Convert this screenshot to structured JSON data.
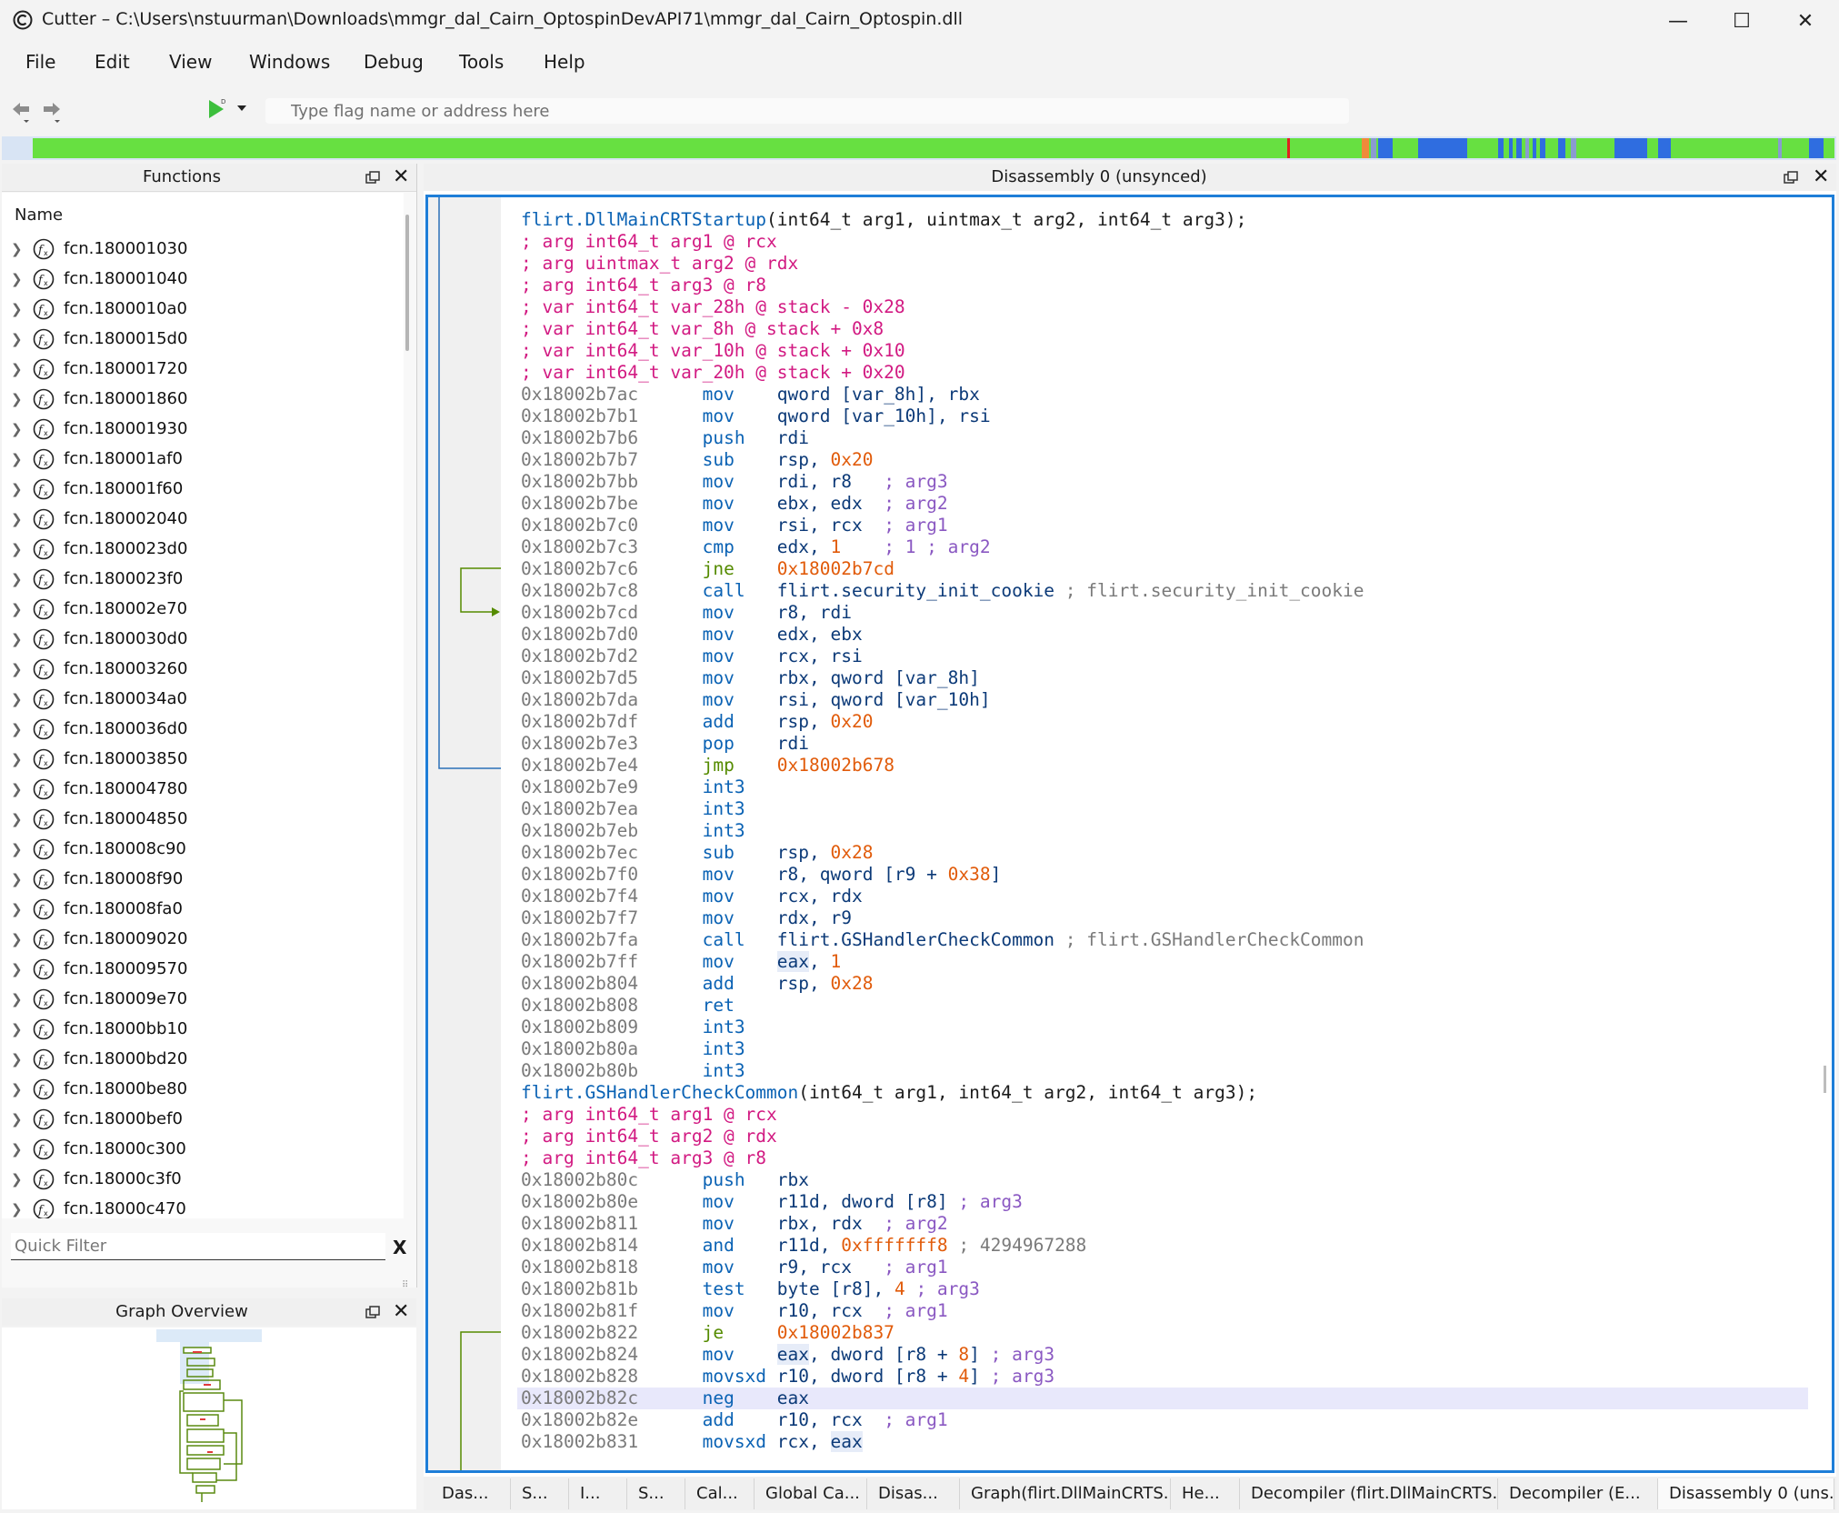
{
  "window": {
    "title": "Cutter – C:\\Users\\nstuurman\\Downloads\\mmgr_dal_Cairn_OptospinDevAPI71\\mmgr_dal_Cairn_Optospin.dll",
    "minimize_glyph": "—",
    "maximize_glyph": "☐",
    "close_glyph": "✕"
  },
  "menu": [
    "File",
    "Edit",
    "View",
    "Windows",
    "Debug",
    "Tools",
    "Help"
  ],
  "toolbar": {
    "search_placeholder": "Type flag name or address here",
    "run_badge": "D"
  },
  "colors": {
    "map_code": "#67e041",
    "map_data": "#2f6de0",
    "map_marker": "#e02020",
    "focus_border": "#1e7ed8"
  },
  "functions_panel": {
    "title": "Functions",
    "column": "Name",
    "filter_placeholder": "Quick Filter",
    "filter_clear": "X",
    "items": [
      "fcn.180001030",
      "fcn.180001040",
      "fcn.1800010a0",
      "fcn.1800015d0",
      "fcn.180001720",
      "fcn.180001860",
      "fcn.180001930",
      "fcn.180001af0",
      "fcn.180001f60",
      "fcn.180002040",
      "fcn.1800023d0",
      "fcn.1800023f0",
      "fcn.180002e70",
      "fcn.1800030d0",
      "fcn.180003260",
      "fcn.1800034a0",
      "fcn.1800036d0",
      "fcn.180003850",
      "fcn.180004780",
      "fcn.180004850",
      "fcn.180008c90",
      "fcn.180008f90",
      "fcn.180008fa0",
      "fcn.180009020",
      "fcn.180009570",
      "fcn.180009e70",
      "fcn.18000bb10",
      "fcn.18000bd20",
      "fcn.18000be80",
      "fcn.18000bef0",
      "fcn.18000c300",
      "fcn.18000c3f0",
      "fcn.18000c470"
    ]
  },
  "graph_overview": {
    "title": "Graph Overview"
  },
  "disassembly": {
    "title": "Disassembly 0 (unsynced)",
    "lines": [
      {
        "k": "fn",
        "name": "flirt.DllMainCRTStartup",
        "sig": "(int64_t arg1, uintmax_t arg2, int64_t arg3);"
      },
      {
        "k": "var",
        "text": "; arg int64_t arg1 @ rcx"
      },
      {
        "k": "var",
        "text": "; arg uintmax_t arg2 @ rdx"
      },
      {
        "k": "var",
        "text": "; arg int64_t arg3 @ r8"
      },
      {
        "k": "var",
        "text": "; var int64_t var_28h @ stack - 0x28"
      },
      {
        "k": "var",
        "text": "; var int64_t var_8h @ stack + 0x8"
      },
      {
        "k": "var",
        "text": "; var int64_t var_10h @ stack + 0x10"
      },
      {
        "k": "var",
        "text": "; var int64_t var_20h @ stack + 0x20"
      },
      {
        "a": "0x18002b7ac",
        "m": "mov",
        "o": [
          [
            "qword [var_8h], rbx",
            "op"
          ]
        ]
      },
      {
        "a": "0x18002b7b1",
        "m": "mov",
        "o": [
          [
            "qword [var_10h], rsi",
            "op"
          ]
        ]
      },
      {
        "a": "0x18002b7b6",
        "m": "push",
        "o": [
          [
            "rdi",
            "op"
          ]
        ]
      },
      {
        "a": "0x18002b7b7",
        "m": "sub",
        "o": [
          [
            "rsp, ",
            "op"
          ],
          [
            "0x20",
            "num"
          ]
        ]
      },
      {
        "a": "0x18002b7bb",
        "m": "mov",
        "o": [
          [
            "rdi, r8   ",
            "op"
          ],
          [
            "; arg3",
            "cmt"
          ]
        ]
      },
      {
        "a": "0x18002b7be",
        "m": "mov",
        "o": [
          [
            "ebx, edx  ",
            "op"
          ],
          [
            "; arg2",
            "cmt"
          ]
        ]
      },
      {
        "a": "0x18002b7c0",
        "m": "mov",
        "o": [
          [
            "rsi, rcx  ",
            "op"
          ],
          [
            "; arg1",
            "cmt"
          ]
        ]
      },
      {
        "a": "0x18002b7c3",
        "m": "cmp",
        "o": [
          [
            "edx, ",
            "op"
          ],
          [
            "1",
            "num"
          ],
          [
            "    ",
            "op"
          ],
          [
            "; 1 ; arg2",
            "cmt"
          ]
        ]
      },
      {
        "a": "0x18002b7c6",
        "m": "jne",
        "j": true,
        "o": [
          [
            "0x18002b7cd",
            "num"
          ]
        ]
      },
      {
        "a": "0x18002b7c8",
        "m": "call",
        "o": [
          [
            "flirt.security_init_cookie ",
            "op"
          ],
          [
            "; flirt.security_init_cookie",
            "ref"
          ]
        ]
      },
      {
        "a": "0x18002b7cd",
        "m": "mov",
        "o": [
          [
            "r8, rdi",
            "op"
          ]
        ]
      },
      {
        "a": "0x18002b7d0",
        "m": "mov",
        "o": [
          [
            "edx, ebx",
            "op"
          ]
        ]
      },
      {
        "a": "0x18002b7d2",
        "m": "mov",
        "o": [
          [
            "rcx, rsi",
            "op"
          ]
        ]
      },
      {
        "a": "0x18002b7d5",
        "m": "mov",
        "o": [
          [
            "rbx, qword [var_8h]",
            "op"
          ]
        ]
      },
      {
        "a": "0x18002b7da",
        "m": "mov",
        "o": [
          [
            "rsi, qword [var_10h]",
            "op"
          ]
        ]
      },
      {
        "a": "0x18002b7df",
        "m": "add",
        "o": [
          [
            "rsp, ",
            "op"
          ],
          [
            "0x20",
            "num"
          ]
        ]
      },
      {
        "a": "0x18002b7e3",
        "m": "pop",
        "o": [
          [
            "rdi",
            "op"
          ]
        ]
      },
      {
        "a": "0x18002b7e4",
        "m": "jmp",
        "j": true,
        "o": [
          [
            "0x18002b678",
            "num"
          ]
        ]
      },
      {
        "a": "0x18002b7e9",
        "m": "int3",
        "o": []
      },
      {
        "a": "0x18002b7ea",
        "m": "int3",
        "o": []
      },
      {
        "a": "0x18002b7eb",
        "m": "int3",
        "o": []
      },
      {
        "a": "0x18002b7ec",
        "m": "sub",
        "o": [
          [
            "rsp, ",
            "op"
          ],
          [
            "0x28",
            "num"
          ]
        ]
      },
      {
        "a": "0x18002b7f0",
        "m": "mov",
        "o": [
          [
            "r8, qword [r9 + ",
            "op"
          ],
          [
            "0x38",
            "num"
          ],
          [
            "]",
            "op"
          ]
        ]
      },
      {
        "a": "0x18002b7f4",
        "m": "mov",
        "o": [
          [
            "rcx, rdx",
            "op"
          ]
        ]
      },
      {
        "a": "0x18002b7f7",
        "m": "mov",
        "o": [
          [
            "rdx, r9",
            "op"
          ]
        ]
      },
      {
        "a": "0x18002b7fa",
        "m": "call",
        "o": [
          [
            "flirt.GSHandlerCheckCommon ",
            "op"
          ],
          [
            "; flirt.GSHandlerCheckCommon",
            "ref"
          ]
        ]
      },
      {
        "a": "0x18002b7ff",
        "m": "mov",
        "o": [
          [
            "eax",
            "hl"
          ],
          [
            ", ",
            "op"
          ],
          [
            "1",
            "num"
          ]
        ]
      },
      {
        "a": "0x18002b804",
        "m": "add",
        "o": [
          [
            "rsp, ",
            "op"
          ],
          [
            "0x28",
            "num"
          ]
        ]
      },
      {
        "a": "0x18002b808",
        "m": "ret",
        "o": []
      },
      {
        "a": "0x18002b809",
        "m": "int3",
        "o": []
      },
      {
        "a": "0x18002b80a",
        "m": "int3",
        "o": []
      },
      {
        "a": "0x18002b80b",
        "m": "int3",
        "o": []
      },
      {
        "k": "fn",
        "name": "flirt.GSHandlerCheckCommon",
        "sig": "(int64_t arg1, int64_t arg2, int64_t arg3);"
      },
      {
        "k": "var",
        "text": "; arg int64_t arg1 @ rcx"
      },
      {
        "k": "var",
        "text": "; arg int64_t arg2 @ rdx"
      },
      {
        "k": "var",
        "text": "; arg int64_t arg3 @ r8"
      },
      {
        "a": "0x18002b80c",
        "m": "push",
        "o": [
          [
            "rbx",
            "op"
          ]
        ]
      },
      {
        "a": "0x18002b80e",
        "m": "mov",
        "o": [
          [
            "r11d, dword [r8] ",
            "op"
          ],
          [
            "; arg3",
            "cmt"
          ]
        ]
      },
      {
        "a": "0x18002b811",
        "m": "mov",
        "o": [
          [
            "rbx, rdx  ",
            "op"
          ],
          [
            "; arg2",
            "cmt"
          ]
        ]
      },
      {
        "a": "0x18002b814",
        "m": "and",
        "o": [
          [
            "r11d, ",
            "op"
          ],
          [
            "0xfffffff8",
            "num"
          ],
          [
            " ",
            "op"
          ],
          [
            "; 4294967288",
            "ref"
          ]
        ]
      },
      {
        "a": "0x18002b818",
        "m": "mov",
        "o": [
          [
            "r9, rcx   ",
            "op"
          ],
          [
            "; arg1",
            "cmt"
          ]
        ]
      },
      {
        "a": "0x18002b81b",
        "m": "test",
        "o": [
          [
            "byte [r8], ",
            "op"
          ],
          [
            "4",
            "num"
          ],
          [
            " ",
            "op"
          ],
          [
            "; arg3",
            "cmt"
          ]
        ]
      },
      {
        "a": "0x18002b81f",
        "m": "mov",
        "o": [
          [
            "r10, rcx  ",
            "op"
          ],
          [
            "; arg1",
            "cmt"
          ]
        ]
      },
      {
        "a": "0x18002b822",
        "m": "je",
        "j": true,
        "o": [
          [
            "0x18002b837",
            "num"
          ]
        ]
      },
      {
        "a": "0x18002b824",
        "m": "mov",
        "o": [
          [
            "eax",
            "hl"
          ],
          [
            ", dword [r8 + ",
            "op"
          ],
          [
            "8",
            "num"
          ],
          [
            "] ",
            "op"
          ],
          [
            "; arg3",
            "cmt"
          ]
        ]
      },
      {
        "a": "0x18002b828",
        "m": "movsxd",
        "o": [
          [
            "r10, dword [r8 + ",
            "op"
          ],
          [
            "4",
            "num"
          ],
          [
            "] ",
            "op"
          ],
          [
            "; arg3",
            "cmt"
          ]
        ]
      },
      {
        "a": "0x18002b82c",
        "m": "neg",
        "hl": true,
        "o": [
          [
            "eax",
            "op"
          ]
        ]
      },
      {
        "a": "0x18002b82e",
        "m": "add",
        "o": [
          [
            "r10, rcx  ",
            "op"
          ],
          [
            "; arg1",
            "cmt"
          ]
        ]
      },
      {
        "a": "0x18002b831",
        "m": "movsxd",
        "o": [
          [
            "rcx, ",
            "op"
          ],
          [
            "eax",
            "hl"
          ]
        ]
      }
    ]
  },
  "tabs": [
    "Das...",
    "S...",
    "I...",
    "S...",
    "Cal...",
    "Global Ca...",
    "Disas...",
    "Graph(flirt.DllMainCRTS...",
    "He...",
    "Decompiler (flirt.DllMainCRTS...",
    "Decompiler (E...",
    "Disassembly 0 (uns..."
  ]
}
